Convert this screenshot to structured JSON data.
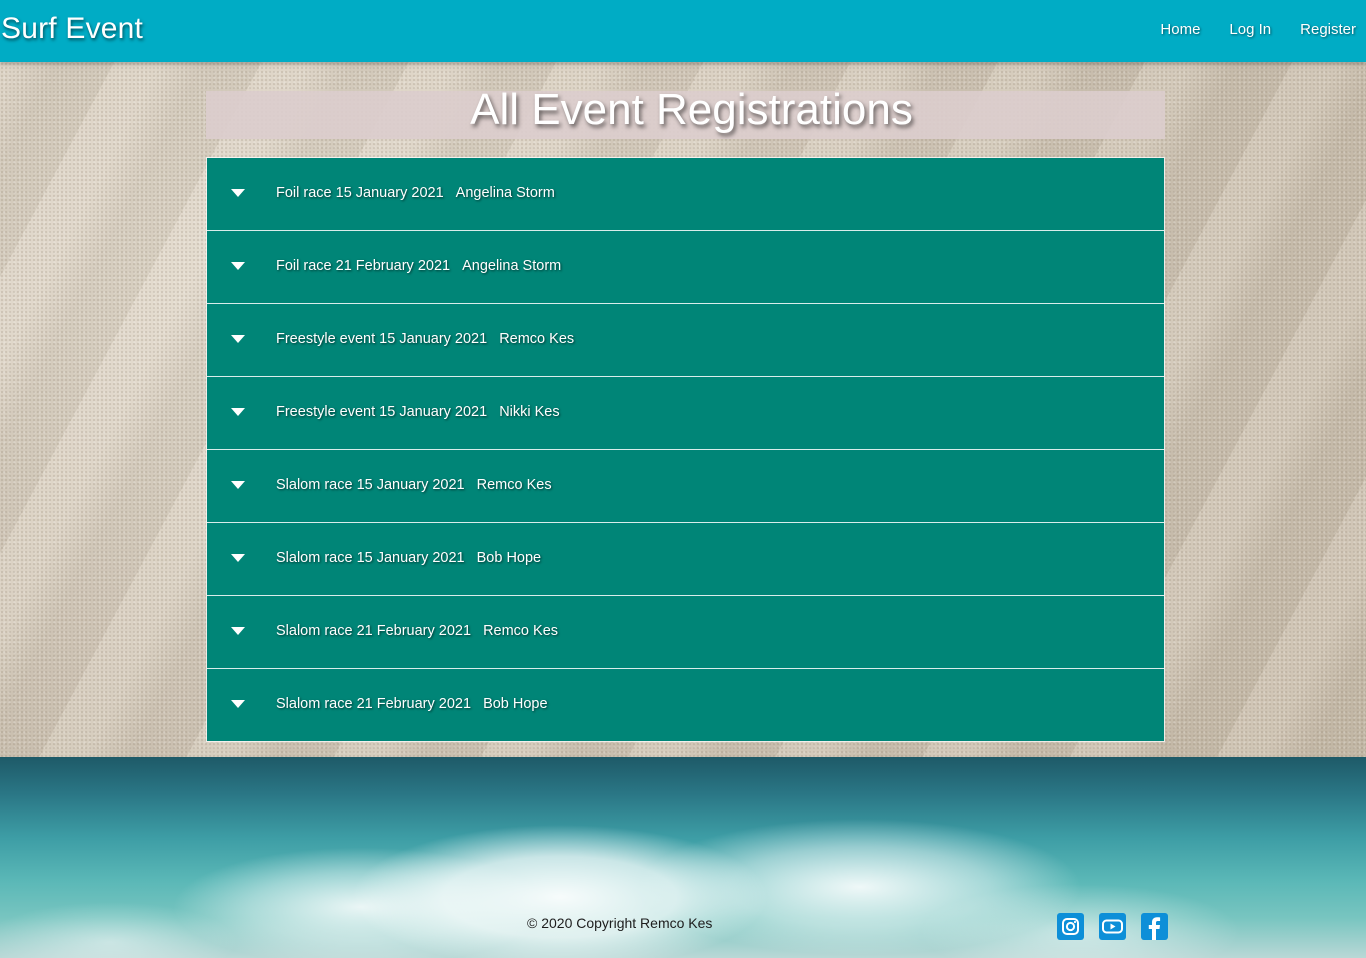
{
  "header": {
    "brand": "Surf Event",
    "nav": [
      {
        "label": "Home"
      },
      {
        "label": "Log In"
      },
      {
        "label": "Register"
      }
    ]
  },
  "main": {
    "title": "All Event Registrations",
    "registrations": [
      {
        "event": "Foil race 15 January 2021",
        "name": "Angelina Storm"
      },
      {
        "event": "Foil race 21 February 2021",
        "name": "Angelina Storm"
      },
      {
        "event": "Freestyle event 15 January 2021",
        "name": "Remco Kes"
      },
      {
        "event": "Freestyle event 15 January 2021",
        "name": "Nikki Kes"
      },
      {
        "event": "Slalom race 15 January 2021",
        "name": "Remco Kes"
      },
      {
        "event": "Slalom race 15 January 2021",
        "name": "Bob Hope"
      },
      {
        "event": "Slalom race 21 February 2021",
        "name": "Remco Kes"
      },
      {
        "event": "Slalom race 21 February 2021",
        "name": "Bob Hope"
      }
    ]
  },
  "footer": {
    "copyright": "© 2020 Copyright Remco Kes",
    "social": [
      {
        "icon": "instagram-icon"
      },
      {
        "icon": "youtube-icon"
      },
      {
        "icon": "facebook-icon"
      }
    ]
  },
  "colors": {
    "navbar": "#00acc5",
    "accordion": "#008577",
    "social_icon": "#0d8fd8"
  }
}
